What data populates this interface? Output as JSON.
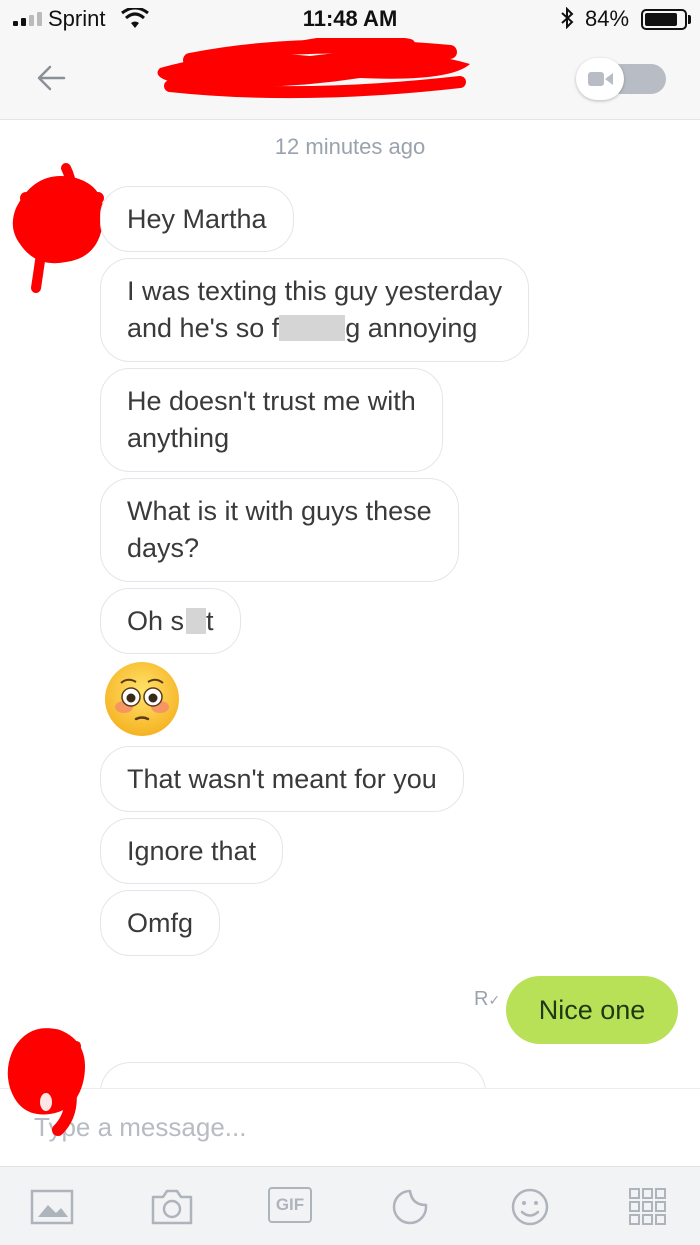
{
  "status_bar": {
    "carrier": "Sprint",
    "time": "11:48 AM",
    "battery_percent": "84%",
    "battery_level": 0.84
  },
  "header": {
    "back_icon": "arrow-left-icon",
    "video_toggle_icon": "video-camera-icon"
  },
  "conversation": {
    "timestamp": "12 minutes ago",
    "incoming": [
      {
        "lines": [
          "Hey Martha"
        ]
      },
      {
        "lines": [
          "I was texting this guy yesterday",
          "and he's so f",
          "g annoying"
        ]
      },
      {
        "lines": [
          "He doesn't trust me with",
          "anything"
        ]
      },
      {
        "lines": [
          "What is it with guys these",
          "days?"
        ]
      },
      {
        "lines": [
          "Oh s",
          "t"
        ]
      },
      {
        "lines": [
          "That wasn't meant for you"
        ]
      },
      {
        "lines": [
          "Ignore that"
        ]
      },
      {
        "lines": [
          "Omfg"
        ]
      }
    ],
    "emoji": "flushed-face-emoji",
    "outgoing": {
      "text": "Nice one",
      "read_mark": "R"
    }
  },
  "composer": {
    "placeholder": "Type a message..."
  },
  "toolbar": {
    "items": [
      "image-icon",
      "camera-icon",
      "gif-icon",
      "sticker-icon",
      "smiley-icon",
      "grid-icon"
    ],
    "gif_label": "GIF"
  },
  "colors": {
    "outgoing_bubble": "#b8e158",
    "redaction": "#ff0000",
    "timestamp": "#9aa3ad",
    "toolbar_icon": "#aeb4bc"
  }
}
